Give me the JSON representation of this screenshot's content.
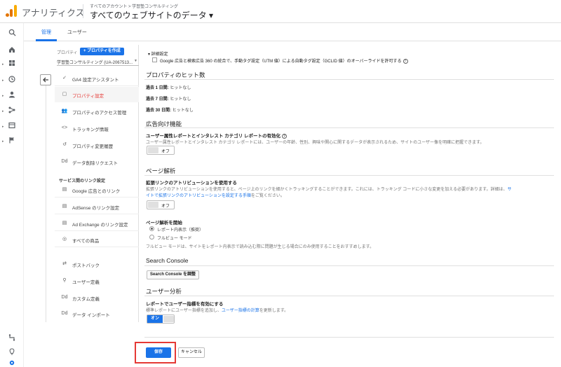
{
  "header": {
    "app_title": "アナリティクス",
    "breadcrumb": "すべてのアカウント > 学習塾コンサルティング",
    "view_title": "すべてのウェブサイトのデータ ▾"
  },
  "rail": {
    "icons": [
      "search-icon",
      "home-icon",
      "customization-icon",
      "realtime-icon",
      "audience-icon",
      "acquisition-icon",
      "behavior-icon",
      "conversions-icon"
    ],
    "bottom_icons": [
      "attribution-icon",
      "discover-icon",
      "admin-icon"
    ]
  },
  "tabs": [
    {
      "label": "管理",
      "active": true
    },
    {
      "label": "ユーザー",
      "active": false
    }
  ],
  "property": {
    "label": "プロパティ",
    "create_button": "+ プロパティを作成",
    "selected": "学習塾コンサルティング (UA-2067513..."
  },
  "nav": {
    "items": [
      {
        "label": "GA4 設定アシスタント",
        "icon": "✓"
      },
      {
        "label": "プロパティ設定",
        "icon": "▢"
      },
      {
        "label": "プロパティのアクセス管理",
        "icon": "👥"
      },
      {
        "label": "トラッキング情報",
        "icon": "<>"
      },
      {
        "label": "プロパティ変更履歴",
        "icon": "↺"
      },
      {
        "label": "データ削除リクエスト",
        "icon": "Dd"
      }
    ],
    "section_title": "サービス間のリンク設定",
    "link_items": [
      {
        "label": "Google 広告とのリンク",
        "icon": "▤"
      },
      {
        "label": "AdSense のリンク設定",
        "icon": "▤"
      },
      {
        "label": "Ad Exchange のリンク設定",
        "icon": "▤"
      },
      {
        "label": "すべての商品",
        "icon": "◎"
      }
    ],
    "other_items": [
      {
        "label": "ポストバック",
        "icon": "⇄"
      },
      {
        "label": "ユーザー定義",
        "icon": "⚲"
      },
      {
        "label": "カスタム定義",
        "icon": "Dd"
      },
      {
        "label": "データ インポート",
        "icon": "Dd"
      }
    ]
  },
  "main": {
    "advanced": {
      "title": "▾ 詳細設定",
      "checkbox_label": "Google 広告と検索広告 360 の統合で、手動タグ設定（UTM 値）による自動タグ設定（GCLID 値）のオーバーライドを許可する"
    },
    "hits": {
      "title": "プロパティのヒット数",
      "rows": [
        {
          "label": "過去 1 日間:",
          "value": "ヒットなし"
        },
        {
          "label": "過去 7 日間:",
          "value": "ヒットなし"
        },
        {
          "label": "過去 30 日間:",
          "value": "ヒットなし"
        }
      ]
    },
    "ads": {
      "title": "広告向け機能",
      "setting_title": "ユーザー属性レポートとインタレスト カテゴリ レポートの有効化",
      "setting_desc": "ユーザー属性レポートとインタレスト カテゴリ レポートには、ユーザーの年齢、性別、興味や関心に関するデータが表示されるため、サイトのユーザー像を明確に把握できます。",
      "toggle_label": "オフ"
    },
    "page_analysis": {
      "title": "ページ解析",
      "setting_title": "拡張リンクのアトリビューションを使用する",
      "desc_line1_a": "拡張リンクのアトリビューションを使用すると、ページ上のリンクを細かくトラッキングすることができます。これには、トラッキング コードに小さな変更を加える必要があります。詳細は、",
      "desc_line1_link": "サ",
      "desc_line2_link": "イトで拡張リンクのアトリビューションを設定する手順",
      "desc_line2_b": "をご覧ください。",
      "toggle_label": "オフ",
      "start_title": "ページ解析を開始",
      "radio1": "レポート内表示（推奨）",
      "radio2": "フルビュー モード",
      "radio_note": "フルビュー モードは、サイトをレポート内表示で読み込む際に問題が生じる場合にのみ使用することをおすすめします。"
    },
    "search_console": {
      "title": "Search Console",
      "button": "Search Console を調整"
    },
    "user_analysis": {
      "title": "ユーザー分析",
      "setting_title": "レポートでユーザー指標を有効にする",
      "desc_a": "標準レポートにユーザー指標を追加し、",
      "desc_link": "ユーザー指標の計算",
      "desc_b": "を更新します。",
      "toggle_label": "オン"
    }
  },
  "footer": {
    "save": "保存",
    "cancel": "キャンセル"
  },
  "colors": {
    "accent": "#1a73e8",
    "highlight": "#e53935"
  }
}
